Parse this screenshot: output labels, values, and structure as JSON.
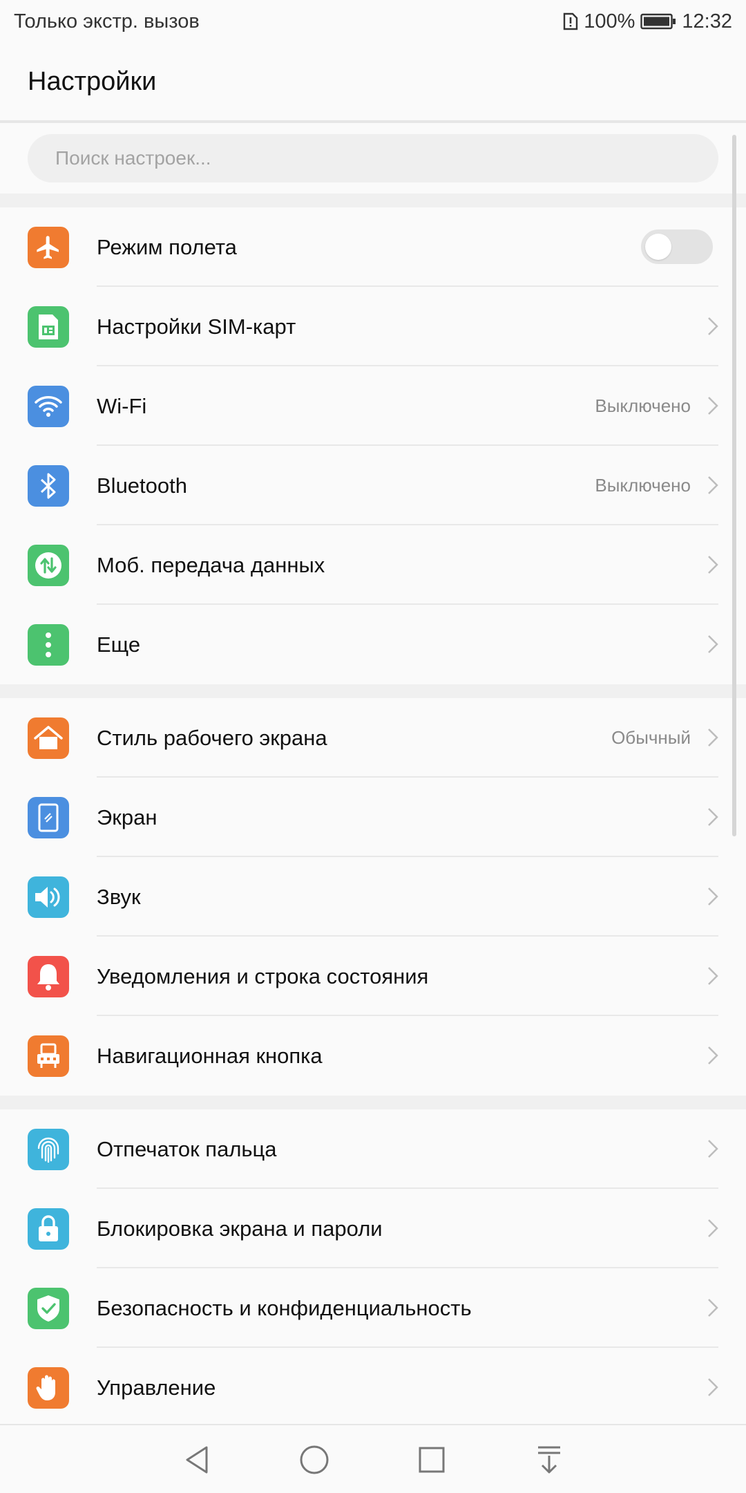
{
  "status_bar": {
    "carrier_text": "Только экстр. вызов",
    "battery_percent": "100%",
    "time": "12:32"
  },
  "header": {
    "title": "Настройки"
  },
  "search": {
    "placeholder": "Поиск настроек..."
  },
  "sections": [
    {
      "items": [
        {
          "label": "Режим полета",
          "icon": "airplane-icon",
          "icon_color": "#f07b30",
          "toggle": "off"
        },
        {
          "label": "Настройки SIM-карт",
          "icon": "sim-card-icon",
          "icon_color": "#4cc36f"
        },
        {
          "label": "Wi-Fi",
          "icon": "wifi-icon",
          "icon_color": "#4b8fe0",
          "value": "Выключено"
        },
        {
          "label": "Bluetooth",
          "icon": "bluetooth-icon",
          "icon_color": "#4b8fe0",
          "value": "Выключено"
        },
        {
          "label": "Моб. передача данных",
          "icon": "mobile-data-icon",
          "icon_color": "#4cc36f"
        },
        {
          "label": "Еще",
          "icon": "more-icon",
          "icon_color": "#4cc36f"
        }
      ]
    },
    {
      "items": [
        {
          "label": "Стиль рабочего экрана",
          "icon": "home-icon",
          "icon_color": "#f07b30",
          "value": "Обычный"
        },
        {
          "label": "Экран",
          "icon": "display-icon",
          "icon_color": "#4b8fe0"
        },
        {
          "label": "Звук",
          "icon": "sound-icon",
          "icon_color": "#3fb4dc"
        },
        {
          "label": "Уведомления и строка состояния",
          "icon": "bell-icon",
          "icon_color": "#f2524a"
        },
        {
          "label": "Навигационная кнопка",
          "icon": "navigation-key-icon",
          "icon_color": "#f07b30"
        }
      ]
    },
    {
      "items": [
        {
          "label": "Отпечаток пальца",
          "icon": "fingerprint-icon",
          "icon_color": "#3fb4dc"
        },
        {
          "label": "Блокировка экрана и пароли",
          "icon": "lock-icon",
          "icon_color": "#3fb4dc"
        },
        {
          "label": "Безопасность и конфиденциальность",
          "icon": "shield-icon",
          "icon_color": "#4cc36f"
        },
        {
          "label": "Управление",
          "icon": "hand-icon",
          "icon_color": "#f07b30"
        }
      ]
    }
  ],
  "nav_bar": {
    "buttons": [
      "back-icon",
      "home-circle-icon",
      "recents-icon",
      "notification-pull-icon"
    ]
  }
}
